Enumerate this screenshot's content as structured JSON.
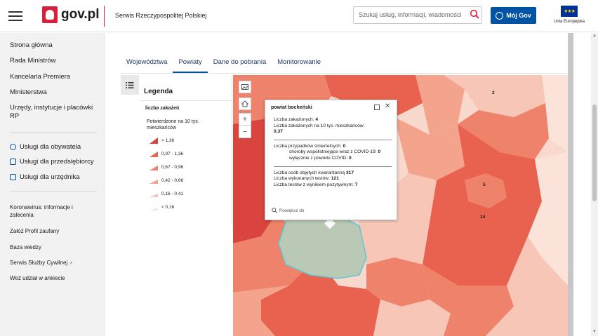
{
  "header": {
    "logo_text": "gov.pl",
    "service_name": "Serwis Rzeczypospolitej Polskiej",
    "search_placeholder": "Szukaj usług, informacji, wiadomości",
    "my_gov_label": "Mój Gov",
    "eu_label": "Unia Europejska"
  },
  "sidebar": {
    "primary": [
      "Strona główna",
      "Rada Ministrów",
      "Kancelaria Premiera",
      "Ministerstwa"
    ],
    "institutions": "Urzędy, instytucje i placówki RP",
    "services": [
      {
        "label": "Usługi dla obywatela",
        "icon": "user-icon"
      },
      {
        "label": "Usługi dla przedsiębiorcy",
        "icon": "briefcase-icon"
      },
      {
        "label": "Usługi dla urzędnika",
        "icon": "laptop-icon"
      }
    ],
    "secondary": [
      "Koronawirus: informacje i zalecenia",
      "Załóż Profil zaufany",
      "Baza wiedzy",
      "Serwis Służby Cywilnej",
      "Weź udział w ankiecie"
    ]
  },
  "tabs": [
    "Województwa",
    "Powiaty",
    "Dane do pobrania",
    "Monitorowanie"
  ],
  "active_tab": "Powiaty",
  "legend": {
    "title": "Legenda",
    "layer": "liczba zakażeń",
    "subtitle": "Potwierdzone na 10 tys. mieszkańców",
    "classes": [
      {
        "label": "> 1,36",
        "color": "#d9443f"
      },
      {
        "label": "0,97 - 1,36",
        "color": "#e8624f"
      },
      {
        "label": "0,67 - 0,96",
        "color": "#ef826a"
      },
      {
        "label": "0,42 - 0,66",
        "color": "#f4a48d"
      },
      {
        "label": "0,16 - 0,41",
        "color": "#f8c6b6"
      },
      {
        "label": "< 0,16",
        "color": "#fbe3da"
      }
    ]
  },
  "map": {
    "labels": [
      "2",
      "5",
      "14"
    ],
    "selected_color": "#b9c9b5",
    "selected_outline": "#5ec8d1"
  },
  "popup": {
    "title": "powiat bocheński",
    "infections_label": "Liczba zakażonych: ",
    "infections_value": "4",
    "per10k_label": "Liczba zakażonych na 10 tys. mieszkańców:",
    "per10k_value": "0,37",
    "deaths_label": "Liczba przypadków śmiertelnych: ",
    "deaths_value": "0",
    "comorb_label": "choroby współistniejące wraz z COVID-19: ",
    "comorb_value": "0",
    "covid_only_label": "wyłącznie z powodu COVID: ",
    "covid_only_value": "0",
    "quarantine_label": "Liczba osób objętych kwarantanną ",
    "quarantine_value": "317",
    "tests_label": "Liczba wykonanych testów: ",
    "tests_value": "121",
    "positive_label": "Liczba testów z wynikiem pozytywnym: ",
    "positive_value": "7",
    "zoom_label": "Powiększ do"
  }
}
